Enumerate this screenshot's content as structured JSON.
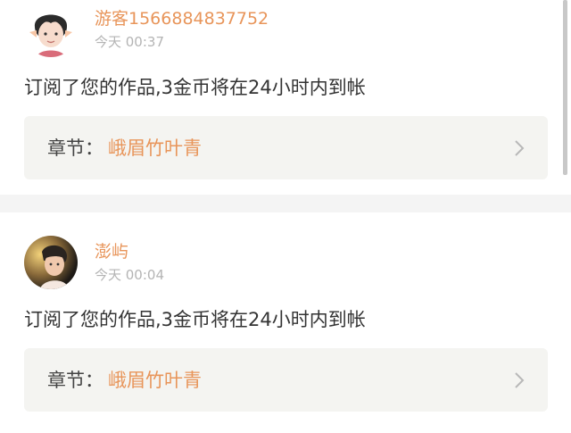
{
  "notifications": [
    {
      "username": "游客1566884837752",
      "time": "今天 00:37",
      "message": "订阅了您的作品,3金币将在24小时内到帐",
      "chapter_label": "章节：",
      "chapter_title": "峨眉竹叶青"
    },
    {
      "username": "澎屿",
      "time": "今天 00:04",
      "message": "订阅了您的作品,3金币将在24小时内到帐",
      "chapter_label": "章节：",
      "chapter_title": "峨眉竹叶青"
    }
  ],
  "colors": {
    "accent": "#e8955a",
    "timestamp": "#b4b4b4",
    "text": "#333333",
    "chapter_bg": "#f4f4f1",
    "page_bg": "#f4f4f4"
  },
  "icons": {
    "chevron": "chevron-right-icon"
  }
}
